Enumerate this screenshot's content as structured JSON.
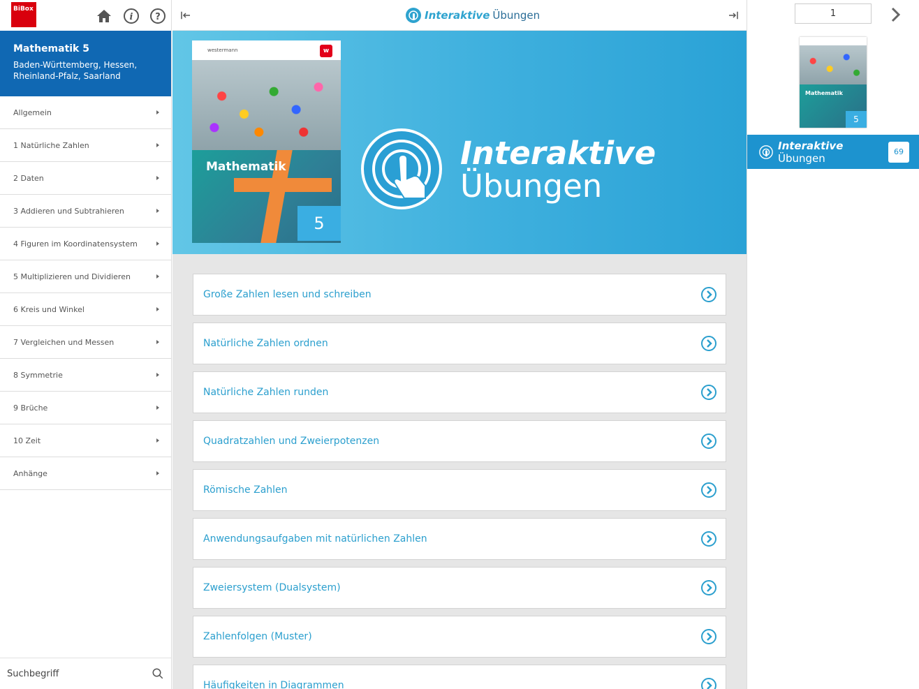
{
  "app": {
    "logo_text": "BiBox"
  },
  "sidebar": {
    "book_title": "Mathematik 5",
    "book_subtitle": "Baden-Württemberg, Hessen, Rheinland-Pfalz, Saarland",
    "items": [
      {
        "label": "Allgemein"
      },
      {
        "label": "1 Natürliche Zahlen"
      },
      {
        "label": "2 Daten"
      },
      {
        "label": "3 Addieren und Subtrahieren"
      },
      {
        "label": "4 Figuren im Koordinatensystem"
      },
      {
        "label": "5 Multiplizieren und Dividieren"
      },
      {
        "label": "6 Kreis und Winkel"
      },
      {
        "label": "7 Vergleichen und Messen"
      },
      {
        "label": "8 Symmetrie"
      },
      {
        "label": "9 Brüche"
      },
      {
        "label": "10 Zeit"
      },
      {
        "label": "Anhänge"
      }
    ],
    "search_placeholder": "Suchbegriff"
  },
  "header": {
    "brand_italic": "Interaktive",
    "brand_regular": "Übungen"
  },
  "hero": {
    "publisher": "westermann",
    "cover_title": "Mathematik",
    "cover_number": "5",
    "title_line1": "Interaktive",
    "title_line2": "Übungen"
  },
  "exercises": [
    {
      "label": "Große Zahlen lesen und schreiben"
    },
    {
      "label": "Natürliche Zahlen ordnen"
    },
    {
      "label": "Natürliche Zahlen runden"
    },
    {
      "label": "Quadratzahlen und Zweierpotenzen"
    },
    {
      "label": "Römische Zahlen"
    },
    {
      "label": "Anwendungsaufgaben mit natürlichen Zahlen"
    },
    {
      "label": "Zweiersystem (Dualsystem)"
    },
    {
      "label": "Zahlenfolgen (Muster)"
    },
    {
      "label": "Häufigkeiten in Diagrammen"
    }
  ],
  "right_panel": {
    "page_number": "1",
    "thumb_title": "Mathematik",
    "thumb_number": "5",
    "active_chapter_italic": "Interaktive",
    "active_chapter_regular": "Übungen",
    "count": "69"
  },
  "colors": {
    "sidebar_header": "#1068b3",
    "accent": "#2b9fce",
    "active_chapter": "#1d93cf",
    "logo": "#d9000d"
  }
}
